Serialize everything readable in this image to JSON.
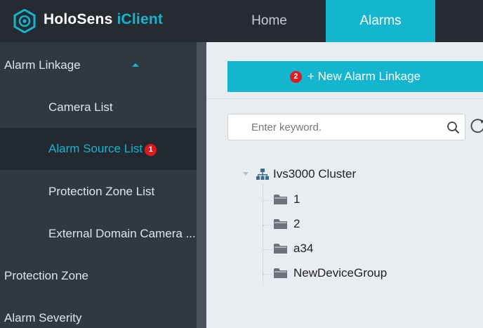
{
  "header": {
    "brand_main": "HoloSens ",
    "brand_accent": "iClient",
    "logo_icon": "holosens-logo-icon",
    "tabs": [
      {
        "label": "Home",
        "active": false
      },
      {
        "label": "Alarms",
        "active": true
      }
    ]
  },
  "sidebar": {
    "items": [
      {
        "label": "Alarm Linkage",
        "level": "top",
        "expanded": true
      },
      {
        "label": "Camera List",
        "level": "sub"
      },
      {
        "label": "Alarm Source List",
        "level": "sub",
        "active": true,
        "badge": "1"
      },
      {
        "label": "Protection Zone List",
        "level": "sub"
      },
      {
        "label": "External Domain Camera ...",
        "level": "sub"
      },
      {
        "label": "Protection Zone",
        "level": "top"
      },
      {
        "label": "Alarm Severity",
        "level": "top"
      }
    ]
  },
  "main": {
    "new_button": {
      "badge": "2",
      "label": "+ New Alarm Linkage"
    },
    "search": {
      "placeholder": "Enter keyword.",
      "value": ""
    },
    "tree": {
      "root": {
        "label": "Ivs3000 Cluster",
        "icon": "cluster-icon"
      },
      "children": [
        {
          "label": "1",
          "icon": "folder-icon"
        },
        {
          "label": "2",
          "icon": "folder-icon"
        },
        {
          "label": "a34",
          "icon": "folder-icon"
        },
        {
          "label": "NewDeviceGroup",
          "icon": "folder-icon"
        }
      ]
    }
  },
  "colors": {
    "accent": "#13b5cf",
    "header_bg": "#262b31",
    "sidebar_bg": "#303841",
    "sidebar_active_bg": "#232930",
    "content_bg": "#e9ecf0",
    "badge": "#e0191e"
  }
}
